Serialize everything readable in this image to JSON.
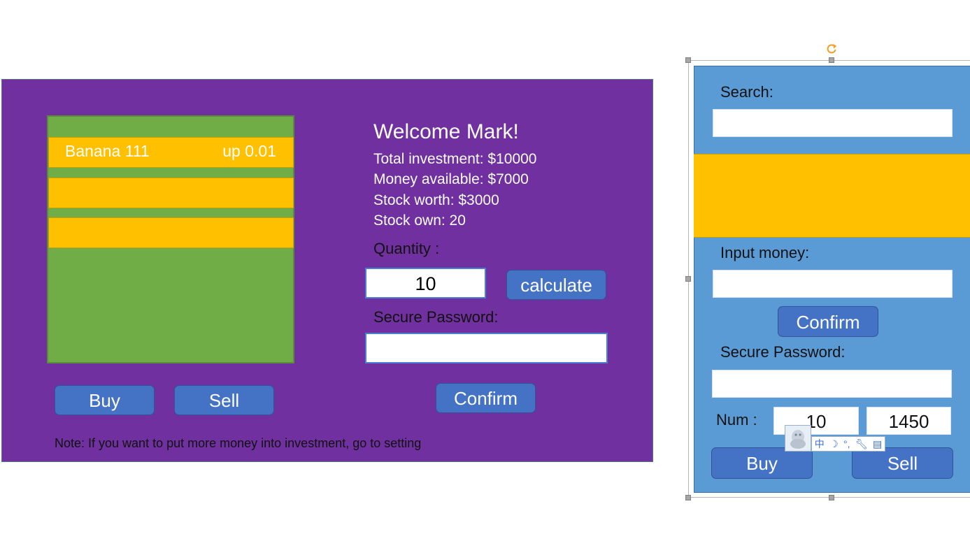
{
  "left_panel": {
    "stocks": [
      {
        "name": "Banana 111",
        "change": "up 0.01"
      },
      {
        "name": "",
        "change": ""
      },
      {
        "name": "",
        "change": ""
      }
    ],
    "buy_label": "Buy",
    "sell_label": "Sell",
    "welcome": "Welcome Mark!",
    "total_investment": "Total investment: $10000",
    "money_available": "Money available: $7000",
    "stock_worth": "Stock worth: $3000",
    "stock_own": "Stock own: 20",
    "quantity_label": "Quantity :",
    "quantity_value": "10",
    "calculate_label": "calculate",
    "secure_password_label": "Secure Password:",
    "confirm_label": "Confirm",
    "note": "Note: If you want to put more money into investment, go to setting"
  },
  "side_panel": {
    "search_label": "Search:",
    "input_money_label": "Input money:",
    "confirm_label": "Confirm",
    "secure_password_label": "Secure Password:",
    "num_label": "Num :",
    "num_value": "10",
    "total_value": "1450",
    "buy_label": "Buy",
    "sell_label": "Sell"
  },
  "ime_toolbar": {
    "lang_label": "中",
    "icons": [
      "moon-icon",
      "punctuation-icon",
      "wrench-icon",
      "clipboard-icon"
    ]
  },
  "colors": {
    "purple_panel": "#7030a0",
    "green_list": "#70ad47",
    "yellow_row": "#ffc000",
    "button_blue": "#4472c4",
    "side_blue": "#5b9bd5"
  }
}
